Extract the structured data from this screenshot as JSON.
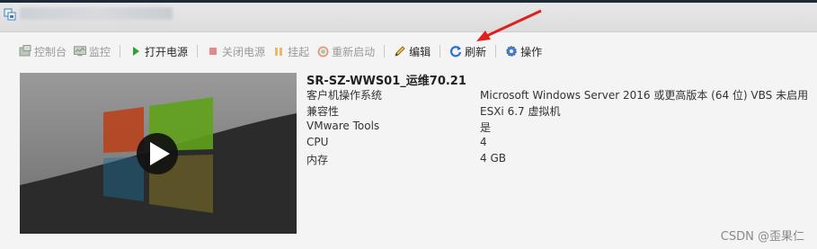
{
  "window": {
    "icon": "vm-icon"
  },
  "toolbar": {
    "items": [
      {
        "label": "控制台",
        "icon": "console-icon",
        "enabled": false
      },
      {
        "label": "监控",
        "icon": "monitor-icon",
        "enabled": false
      },
      {
        "label": "打开电源",
        "icon": "power-on-icon",
        "enabled": true
      },
      {
        "label": "关闭电源",
        "icon": "power-off-icon",
        "enabled": false
      },
      {
        "label": "挂起",
        "icon": "suspend-icon",
        "enabled": false
      },
      {
        "label": "重新启动",
        "icon": "restart-icon",
        "enabled": false
      },
      {
        "label": "编辑",
        "icon": "pencil-icon",
        "enabled": true
      },
      {
        "label": "刷新",
        "icon": "refresh-icon",
        "enabled": true
      },
      {
        "label": "操作",
        "icon": "gear-icon",
        "enabled": true
      }
    ]
  },
  "vm": {
    "name": "SR-SZ-WWS01_运维70.21",
    "details": [
      {
        "key": "客户机操作系统",
        "value": "Microsoft Windows Server 2016 或更高版本 (64 位) VBS 未启用"
      },
      {
        "key": "兼容性",
        "value": "ESXi 6.7 虚拟机"
      },
      {
        "key": "VMware Tools",
        "value": "是"
      },
      {
        "key": "CPU",
        "value": "4"
      },
      {
        "key": "内存",
        "value": "4 GB"
      }
    ]
  },
  "watermark": "CSDN @歪果仁",
  "colors": {
    "accent_arrow": "#e0201b",
    "power_on": "#2ea32e",
    "refresh": "#2a6fd0"
  }
}
